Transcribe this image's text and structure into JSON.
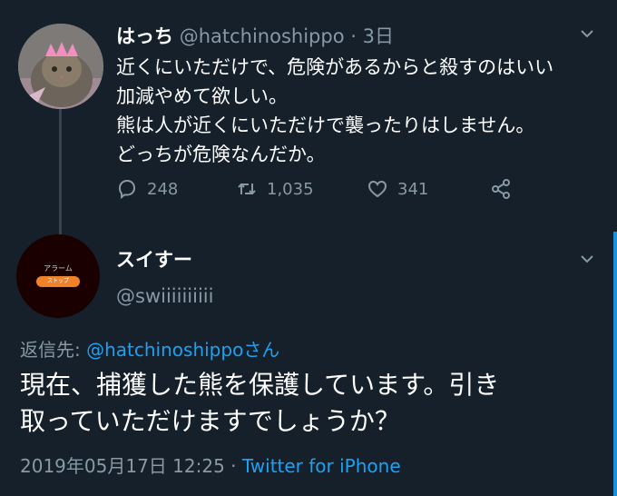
{
  "tweet1": {
    "name": "はっち",
    "handle": "@hatchinoshippo",
    "dot": "·",
    "time": "3日",
    "lines": [
      "近くにいただけで、危険があるからと殺すのはいい",
      "加減やめて欲しい。",
      "熊は人が近くにいただけで襲ったりはしません。",
      "どっちが危険なんだか。"
    ],
    "reply_count": "248",
    "retweet_count": "1,035",
    "like_count": "341"
  },
  "tweet2": {
    "name": "スイすー",
    "handle": "@swiiiiiiiiii",
    "avatar_text": "アラーム",
    "avatar_button": "ストップ",
    "replying_prefix": "返信先: ",
    "replying_to": "@hatchinoshippoさん",
    "lines": [
      "現在、捕獲した熊を保護しています。引き",
      "取っていただけますでしょうか？"
    ],
    "timestamp": "2019年05月17日 12:25",
    "separator": " · ",
    "source": "Twitter for iPhone"
  },
  "colors": {
    "background": "#15202b",
    "secondary_text": "#8899a6",
    "link": "#1da1f2"
  },
  "icons": [
    "chevron-down-icon",
    "reply-icon",
    "retweet-icon",
    "like-icon",
    "share-icon"
  ]
}
